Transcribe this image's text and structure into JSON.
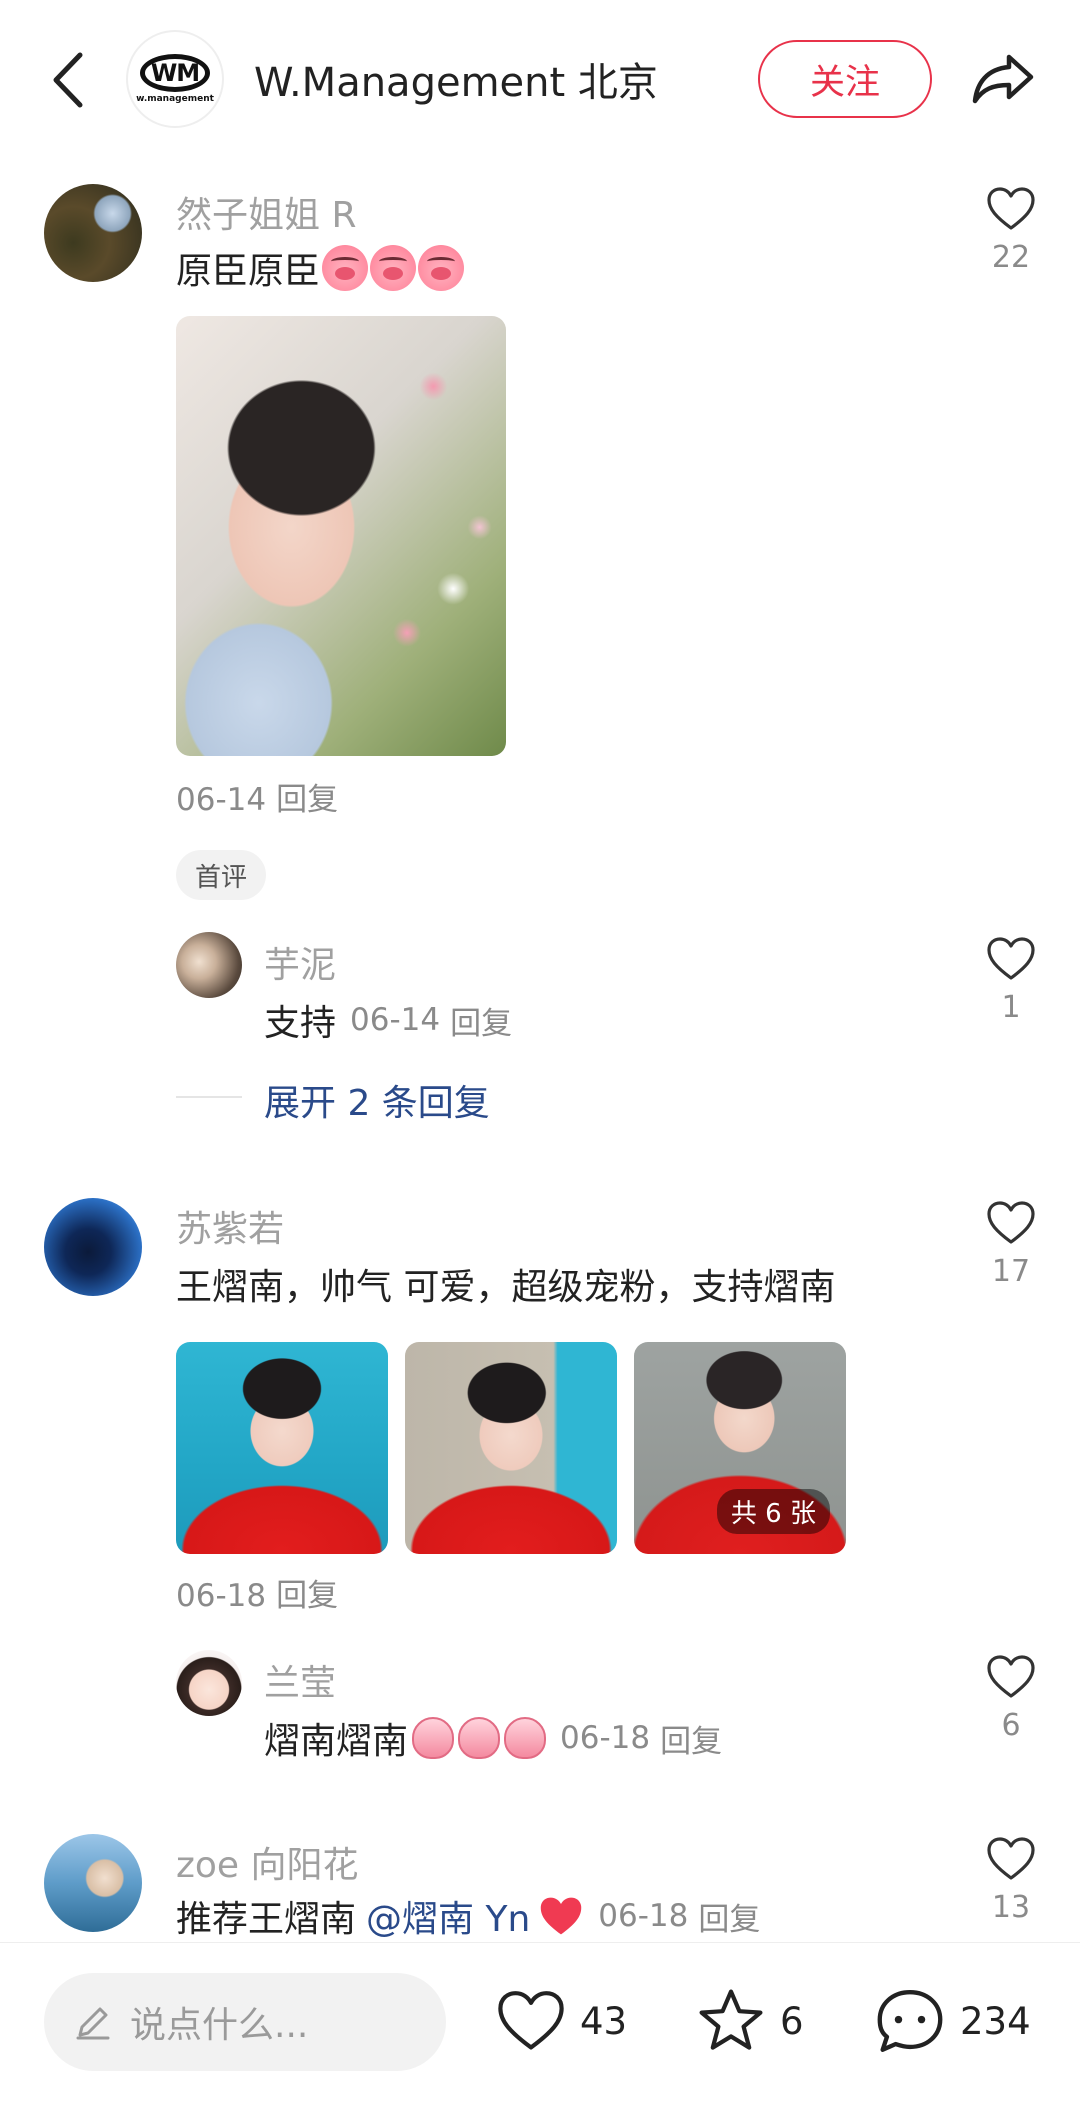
{
  "header": {
    "logo_text": "WM",
    "logo_subtext": "w.management",
    "title": "W.Management 北京",
    "follow_label": "关注"
  },
  "comments": [
    {
      "username": "然子姐姐 R",
      "text": "原臣原臣",
      "likes": "22",
      "date": "06-14",
      "reply_label": "回复",
      "tag": "首评",
      "replies": [
        {
          "username": "芋泥",
          "text": "支持",
          "date": "06-14",
          "reply_label": "回复",
          "likes": "1"
        }
      ],
      "expand_label": "展开 2 条回复"
    },
    {
      "username": "苏紫若",
      "text": "王熠南，帅气  可爱，超级宠粉，支持熠南",
      "likes": "17",
      "date": "06-18",
      "reply_label": "回复",
      "photo_count_label": "共 6 张",
      "replies": [
        {
          "username": "兰莹",
          "text": "熠南熠南",
          "date": "06-18",
          "reply_label": "回复",
          "likes": "6"
        }
      ]
    },
    {
      "username": "zoe 向阳花",
      "text": "推荐王熠南",
      "mention": "@熠南 Yn",
      "date": "06-18",
      "reply_label": "回复",
      "likes": "13"
    }
  ],
  "bottom_bar": {
    "input_placeholder": "说点什么...",
    "like_count": "43",
    "favorite_count": "6",
    "comment_count": "234"
  },
  "colors": {
    "accent": "#e8324a",
    "link": "#2a4a8a",
    "muted": "#8a8a8a"
  }
}
